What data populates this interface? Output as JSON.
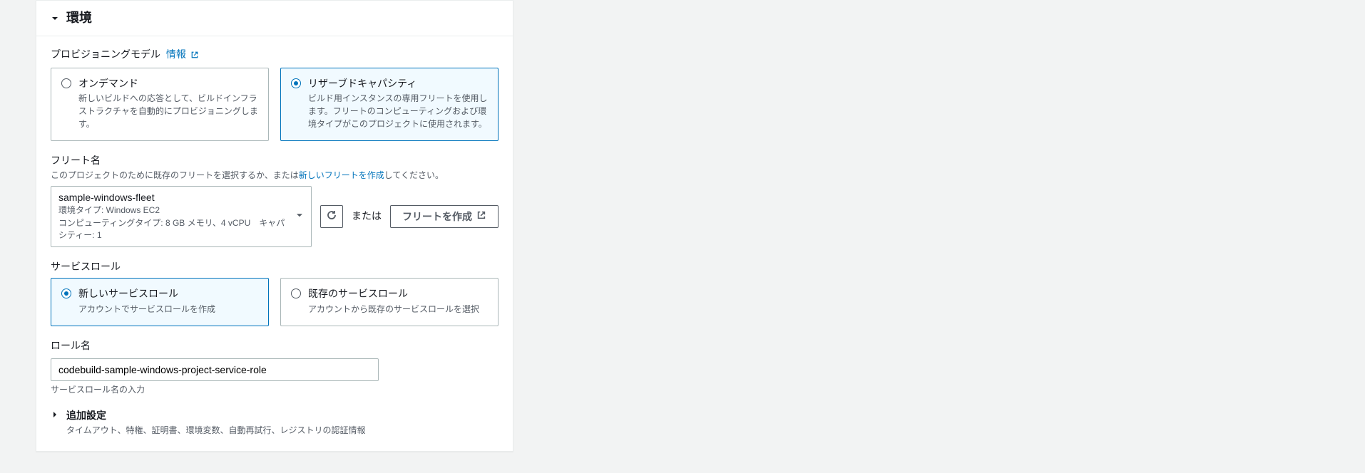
{
  "panel": {
    "title": "環境"
  },
  "provisioning": {
    "label": "プロビジョニングモデル",
    "infoText": "情報",
    "options": [
      {
        "title": "オンデマンド",
        "desc": "新しいビルドへの応答として、ビルドインフラストラクチャを自動的にプロビジョニングします。"
      },
      {
        "title": "リザーブドキャパシティ",
        "desc": "ビルド用インスタンスの専用フリートを使用します。フリートのコンピューティングおよび環境タイプがこのプロジェクトに使用されます。"
      }
    ],
    "selected": 1
  },
  "fleet": {
    "label": "フリート名",
    "hintPrefix": "このプロジェクトのために既存のフリートを選択するか、または",
    "hintLink": "新しいフリートを作成",
    "hintSuffix": "してください。",
    "selected": {
      "name": "sample-windows-fleet",
      "envType": "環境タイプ: Windows EC2",
      "compute": "コンピューティングタイプ: 8 GB メモリ、4 vCPU　キャパシティー: 1"
    },
    "orText": "または",
    "createButton": "フリートを作成"
  },
  "serviceRole": {
    "label": "サービスロール",
    "options": [
      {
        "title": "新しいサービスロール",
        "desc": "アカウントでサービスロールを作成"
      },
      {
        "title": "既存のサービスロール",
        "desc": "アカウントから既存のサービスロールを選択"
      }
    ],
    "selected": 0
  },
  "roleName": {
    "label": "ロール名",
    "value": "codebuild-sample-windows-project-service-role",
    "hint": "サービスロール名の入力"
  },
  "additional": {
    "title": "追加設定",
    "desc": "タイムアウト、特権、証明書、環境変数、自動再試行、レジストリの認証情報"
  }
}
